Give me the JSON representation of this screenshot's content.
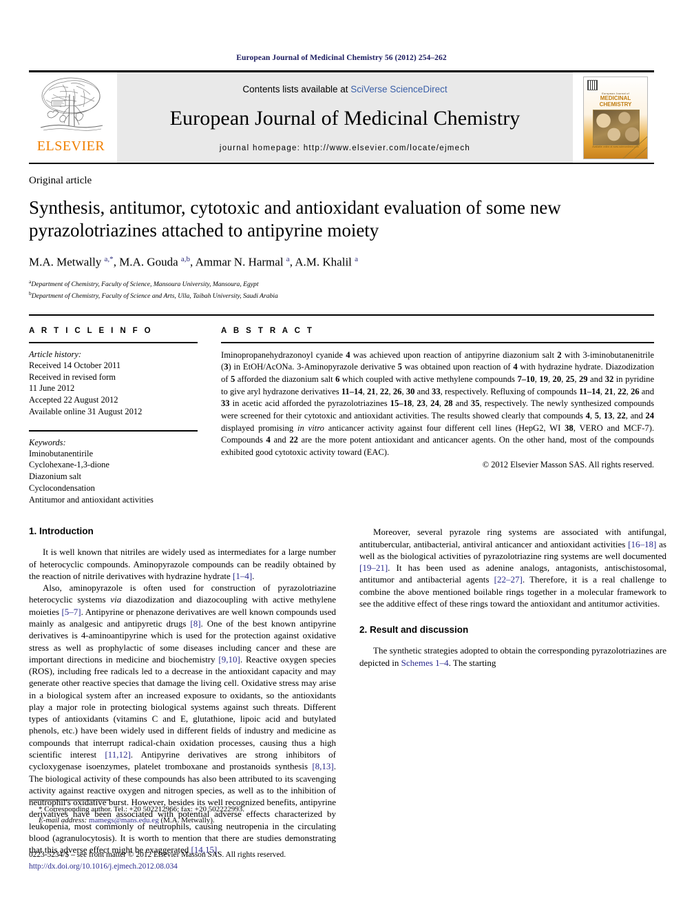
{
  "running_head": "European Journal of Medicinal Chemistry 56 (2012) 254–262",
  "masthead": {
    "publisher_name": "ELSEVIER",
    "contents_prefix": "Contents lists available at ",
    "contents_link": "SciVerse ScienceDirect",
    "journal_name": "European Journal of Medicinal Chemistry",
    "homepage_line": "journal homepage: http://www.elsevier.com/locate/ejmech",
    "cover": {
      "line1": "European Journal of",
      "line2": "MEDICINAL",
      "line3": "CHEMISTRY",
      "caption": "Available online at www.sciencedirect.com"
    }
  },
  "article": {
    "type": "Original article",
    "title": "Synthesis, antitumor, cytotoxic and antioxidant evaluation of some new pyrazolotriazines attached to antipyrine moiety",
    "authors_html": "M.A. Metwally <sup>a,*</sup>, M.A. Gouda <sup>a,b</sup>, Ammar N. Harmal <sup>a</sup>, A.M. Khalil <sup>a</sup>",
    "affiliations": [
      "Department of Chemistry, Faculty of Science, Mansoura University, Mansoura, Egypt",
      "Department of Chemistry, Faculty of Science and Arts, Ulla, Taibah University, Saudi Arabia"
    ],
    "affiliation_marks": [
      "a",
      "b"
    ]
  },
  "article_info": {
    "heading": "A R T I C L E   I N F O",
    "history_label": "Article history:",
    "history": [
      "Received 14 October 2011",
      "Received in revised form",
      "11 June 2012",
      "Accepted 22 August 2012",
      "Available online 31 August 2012"
    ],
    "keywords_label": "Keywords:",
    "keywords": [
      "Iminobutanentirile",
      "Cyclohexane-1,3-dione",
      "Diazonium salt",
      "Cyclocondensation",
      "Antitumor and antioxidant activities"
    ]
  },
  "abstract": {
    "heading": "A B S T R A C T",
    "text": "Iminopropanehydrazonoyl cyanide 4 was achieved upon reaction of antipyrine diazonium salt 2 with 3-iminobutanenitrile (3) in EtOH/AcONa. 3-Aminopyrazole derivative 5 was obtained upon reaction of 4 with hydrazine hydrate. Diazodization of 5 afforded the diazonium salt 6 which coupled with active methylene compounds 7–10, 19, 20, 25, 29 and 32 in pyridine to give aryl hydrazone derivatives 11–14, 21, 22, 26, 30 and 33, respectively. Refluxing of compounds 11–14, 21, 22, 26 and 33 in acetic acid afforded the pyrazolotriazines 15–18, 23, 24, 28 and 35, respectively. The newly synthesized compounds were screened for their cytotoxic and antioxidant activities. The results showed clearly that compounds 4, 5, 13, 22, and 24 displayed promising in vitro anticancer activity against four different cell lines (HepG2, WI 38, VERO and MCF-7). Compounds 4 and 22 are the more potent antioxidant and anticancer agents. On the other hand, most of the compounds exhibited good cytotoxic activity toward (EAC).",
    "copyright": "© 2012 Elsevier Masson SAS. All rights reserved."
  },
  "sections": {
    "introduction_heading": "1. Introduction",
    "results_heading": "2. Result and discussion",
    "intro_p1": "It is well known that nitriles are widely used as intermediates for a large number of heterocyclic compounds. Aminopyrazole compounds can be readily obtained by the reaction of nitrile derivatives with hydrazine hydrate [1–4].",
    "intro_p2": "Also, aminopyrazole is often used for construction of pyrazolotriazine heterocyclic systems via diazodization and diazocoupling with active methylene moieties [5–7]. Antipyrine or phenazone derivatives are well known compounds used mainly as analgesic and antipyretic drugs [8]. One of the best known antipyrine derivatives is 4-aminoantipyrine which is used for the protection against oxidative stress as well as prophylactic of some diseases including cancer and these are important directions in medicine and biochemistry [9,10]. Reactive oxygen species (ROS), including free radicals led to a decrease in the antioxidant capacity and may generate other reactive species that damage the living cell. Oxidative stress may arise in a biological system after an increased exposure to oxidants, so the antioxidants play a major role in protecting biological systems against such threats. Different types of antioxidants (vitamins C and E, glutathione, lipoic acid and butylated phenols, etc.) have been widely used in different fields of industry and medicine as compounds that interrupt radical-chain oxidation processes, causing thus a high scientific interest [11,12]. Antipyrine derivatives are strong inhibitors of cycloxygenase isoenzymes, platelet tromboxane and prostanoids synthesis [8,13]. The biological activity of these compounds has also been attributed to its scavenging activity against reactive oxygen and nitrogen species, as well as to the inhibition of neutrophil's oxidative burst. However, besides its well recognized benefits, antipyrine derivatives have been associated with potential adverse effects characterized by leukopenia, most commonly of neutrophils, causing neutropenia in the circulating blood (agranulocytosis). It is worth to mention that there are studies demonstrating that this adverse effect might be exaggerated [14,15].",
    "intro_p3": "Moreover, several pyrazole ring systems are associated with antifungal, antitubercular, antibacterial, antiviral anticancer and antioxidant activities [16–18] as well as the biological activities of pyrazolotriazine ring systems are well documented [19–21]. It has been used as adenine analogs, antagonists, antischistosomal, antitumor and antibacterial agents [22–27]. Therefore, it is a real challenge to combine the above mentioned boilable rings together in a molecular framework to see the additive effect of these rings toward the antioxidant and antitumor activities.",
    "results_p1": "The synthetic strategies adopted to obtain the corresponding pyrazolotriazines are depicted in Schemes 1–4. The starting"
  },
  "footnote": {
    "corresponding": "* Corresponding author. Tel.: +20 502212966; fax: +20 502222993.",
    "email_label": "E-mail address:",
    "email": "mamegs@mans.edu.eg",
    "email_owner": "(M.A. Metwally)."
  },
  "footer": {
    "issn_line": "0223-5234/$ – see front matter © 2012 Elsevier Masson SAS. All rights reserved.",
    "doi": "http://dx.doi.org/10.1016/j.ejmech.2012.08.034"
  },
  "colors": {
    "link_blue": "#2a2a8c",
    "sd_blue": "#3a5fa8",
    "elsevier_orange": "#f08000",
    "band_grey": "#e9e9e9"
  }
}
